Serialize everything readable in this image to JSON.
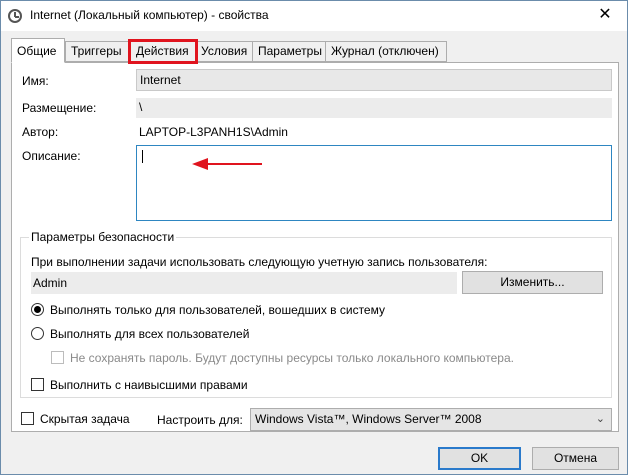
{
  "window": {
    "title": "Internet (Локальный компьютер) - свойства",
    "close_glyph": "✕"
  },
  "tabs": [
    {
      "label": "Общие"
    },
    {
      "label": "Триггеры"
    },
    {
      "label": "Действия"
    },
    {
      "label": "Условия"
    },
    {
      "label": "Параметры"
    },
    {
      "label": "Журнал (отключен)"
    }
  ],
  "general": {
    "name_label": "Имя:",
    "name_value": "Internet",
    "location_label": "Размещение:",
    "location_value": "\\",
    "author_label": "Автор:",
    "author_value": "LAPTOP-L3PANH1S\\Admin",
    "description_label": "Описание:"
  },
  "security": {
    "group_title": "Параметры безопасности",
    "account_prompt": "При выполнении задачи использовать следующую учетную запись пользователя:",
    "account_value": "Admin",
    "change_button": "Изменить...",
    "radio_logged_on": "Выполнять только для пользователей, вошедших в систему",
    "radio_all_users": "Выполнять для всех пользователей",
    "no_save_password": "Не сохранять пароль. Будут доступны ресурсы только локального компьютера.",
    "highest_privileges": "Выполнить с наивысшими правами"
  },
  "footer": {
    "hidden_task": "Скрытая задача",
    "configure_label": "Настроить для:",
    "configure_value": "Windows Vista™, Windows Server™ 2008",
    "ok_button": "OK",
    "cancel_button": "Отмена"
  },
  "colors": {
    "highlight": "#e0141e",
    "arrow": "#e0141e"
  }
}
